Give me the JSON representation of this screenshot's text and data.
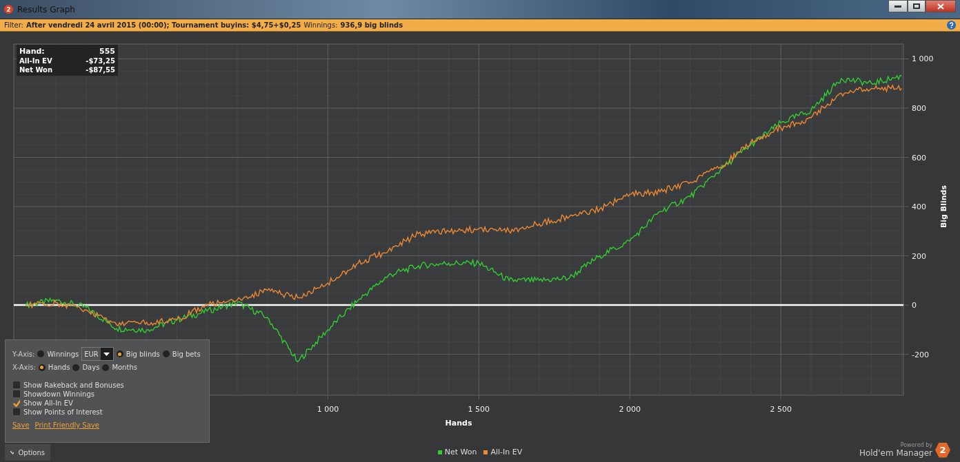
{
  "window": {
    "title": "Results Graph",
    "app_badge": "2"
  },
  "filter_bar": {
    "parts": [
      {
        "label": "Filter:",
        "value": "After vendredi 24 avril 2015 (00:00); Tournament buyins: $4,75+$0,25"
      },
      {
        "label": "Winnings:",
        "value": "936,9 big blinds"
      }
    ]
  },
  "tooltip": {
    "rows": [
      {
        "label": "Hand:",
        "value": "555",
        "bold": true
      },
      {
        "label": "All-In EV",
        "value": "-$73,25",
        "bold": false
      },
      {
        "label": "Net Won",
        "value": "-$87,55",
        "bold": false
      }
    ]
  },
  "chart_data": {
    "type": "line",
    "xlabel": "Hands",
    "ylabel": "Big Blinds",
    "x": [
      0,
      100,
      200,
      300,
      400,
      500,
      600,
      700,
      800,
      900,
      1000,
      1100,
      1200,
      1300,
      1400,
      1500,
      1600,
      1700,
      1800,
      1900,
      2000,
      2100,
      2200,
      2300,
      2400,
      2500,
      2600,
      2700,
      2800,
      2900
    ],
    "series": [
      {
        "name": "Net Won",
        "color": "#33cc33",
        "values": [
          0,
          20,
          -10,
          -95,
          -100,
          -60,
          -25,
          10,
          -50,
          -230,
          -100,
          20,
          120,
          160,
          170,
          170,
          100,
          100,
          110,
          200,
          260,
          380,
          440,
          550,
          650,
          740,
          790,
          920,
          900,
          930
        ]
      },
      {
        "name": "All-In EV",
        "color": "#ee8833",
        "values": [
          0,
          10,
          -20,
          -80,
          -70,
          -60,
          0,
          20,
          60,
          30,
          90,
          170,
          220,
          290,
          300,
          310,
          300,
          330,
          360,
          390,
          450,
          460,
          500,
          560,
          660,
          720,
          760,
          860,
          880,
          880
        ]
      }
    ],
    "grid": true,
    "xlim": [
      -40,
      2906
    ],
    "ylim": [
      -366,
      1060
    ],
    "xticks": [
      {
        "value": 1000,
        "label": "1 000"
      },
      {
        "value": 1500,
        "label": "1 500"
      },
      {
        "value": 2000,
        "label": "2 000"
      },
      {
        "value": 2500,
        "label": "2 500"
      }
    ],
    "yticks": [
      -200,
      0,
      200,
      400,
      600,
      800,
      {
        "value": 1000,
        "label": "1 000"
      }
    ]
  },
  "options": {
    "y_axis": {
      "label": "Y-Axis:",
      "choices": [
        {
          "label": "Winnings",
          "selected": false
        },
        {
          "label": "Big blinds",
          "selected": true
        },
        {
          "label": "Big bets",
          "selected": false
        }
      ],
      "currency": "EUR"
    },
    "x_axis": {
      "label": "X-Axis:",
      "choices": [
        {
          "label": "Hands",
          "selected": true
        },
        {
          "label": "Days",
          "selected": false
        },
        {
          "label": "Months",
          "selected": false
        }
      ]
    },
    "checkboxes": [
      {
        "label": "Show Rakeback and Bonuses",
        "checked": false
      },
      {
        "label": "Showdown Winnings",
        "checked": false
      },
      {
        "label": "Show All-In EV",
        "checked": true
      },
      {
        "label": "Show Points of Interest",
        "checked": false
      }
    ],
    "links": [
      "Save",
      "Print Friendly Save"
    ],
    "toggle": {
      "label": "Options",
      "expanded": true
    }
  },
  "branding": {
    "powered_by": "Powered by",
    "product": "Hold'em Manager",
    "badge": "2"
  }
}
